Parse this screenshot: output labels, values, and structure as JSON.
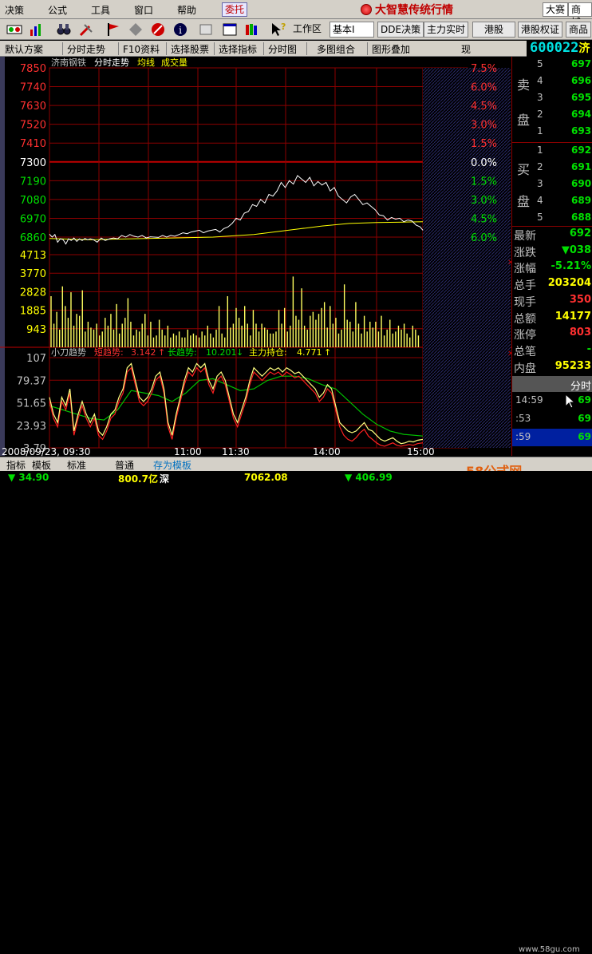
{
  "menu": {
    "items": [
      "决策",
      "公式",
      "工具",
      "窗口",
      "帮助"
    ],
    "weituo": "委托",
    "brand_title": "大智慧传统行情",
    "dasai": "大赛",
    "shangcheng": "商城"
  },
  "toolbar": {
    "workspace_label": "工作区",
    "workspace_value": "基本I",
    "buttons": [
      "DDE决策",
      "主力实时",
      "港股",
      "港股权证",
      "商品"
    ]
  },
  "funcbar": {
    "buttons": [
      "默认方案",
      "分时走势",
      "F10资料",
      "选择股票",
      "选择指标",
      "分时图",
      "多图组合",
      "图形叠加",
      "现"
    ]
  },
  "stock": {
    "code": "600022",
    "name": "济南钢铁",
    "short": "济"
  },
  "chart_data": {
    "type": "line",
    "title": "济南钢铁",
    "tags": [
      "分时走势",
      "均线",
      "成交量"
    ],
    "price_axis": [
      "7850",
      "7740",
      "7630",
      "7520",
      "7410",
      "7300",
      "7190",
      "7080",
      "6970",
      "6860"
    ],
    "pct_axis": [
      "7.5%",
      "6.0%",
      "4.5%",
      "3.0%",
      "1.5%",
      "0.0%",
      "1.5%",
      "3.0%",
      "4.5%",
      "6.0%"
    ],
    "prev_close": 7300,
    "ylim": [
      6860,
      7850
    ],
    "volume_axis": [
      "4713",
      "3770",
      "2828",
      "1885",
      "943"
    ],
    "indicator": {
      "name": "小刀趋势",
      "short_label": "短趋势:",
      "short_value": "3.142",
      "short_arrow": "↑",
      "long_label": "长趋势:",
      "long_value": "10.201",
      "long_arrow": "↓",
      "main_label": "主力持仓:",
      "main_value": "4.771",
      "main_arrow": "↑",
      "axis": [
        "107",
        "79.37",
        "51.65",
        "23.93",
        "3.79"
      ],
      "ylim": [
        0,
        107
      ]
    },
    "x_labels": [
      "2008/09/23, 09:30",
      "11:00",
      "11:30",
      "14:00",
      "15:00"
    ],
    "minutes": 240,
    "price_series": [
      [
        0,
        6877
      ],
      [
        2,
        6860
      ],
      [
        4,
        6875
      ],
      [
        6,
        6830
      ],
      [
        8,
        6850
      ],
      [
        10,
        6845
      ],
      [
        12,
        6820
      ],
      [
        14,
        6850
      ],
      [
        16,
        6840
      ],
      [
        18,
        6855
      ],
      [
        20,
        6835
      ],
      [
        22,
        6850
      ],
      [
        24,
        6840
      ],
      [
        26,
        6852
      ],
      [
        28,
        6845
      ],
      [
        30,
        6850
      ],
      [
        32,
        6846
      ],
      [
        35,
        6830
      ],
      [
        38,
        6855
      ],
      [
        41,
        6840
      ],
      [
        44,
        6850
      ],
      [
        47,
        6855
      ],
      [
        50,
        6850
      ],
      [
        53,
        6870
      ],
      [
        56,
        6860
      ],
      [
        59,
        6875
      ],
      [
        62,
        6865
      ],
      [
        65,
        6860
      ],
      [
        68,
        6870
      ],
      [
        71,
        6855
      ],
      [
        74,
        6862
      ],
      [
        77,
        6860
      ],
      [
        80,
        6858
      ],
      [
        83,
        6870
      ],
      [
        86,
        6860
      ],
      [
        89,
        6870
      ],
      [
        92,
        6865
      ],
      [
        95,
        6875
      ],
      [
        98,
        6885
      ],
      [
        101,
        6880
      ],
      [
        104,
        6890
      ],
      [
        107,
        6895
      ],
      [
        110,
        6900
      ],
      [
        113,
        6885
      ],
      [
        116,
        6895
      ],
      [
        119,
        6900
      ],
      [
        122,
        6905
      ],
      [
        125,
        6890
      ],
      [
        128,
        6910
      ],
      [
        131,
        6920
      ],
      [
        134,
        6940
      ],
      [
        137,
        6970
      ],
      [
        140,
        6960
      ],
      [
        143,
        7000
      ],
      [
        146,
        7010
      ],
      [
        149,
        7050
      ],
      [
        152,
        7040
      ],
      [
        155,
        7080
      ],
      [
        158,
        7060
      ],
      [
        161,
        7110
      ],
      [
        164,
        7100
      ],
      [
        167,
        7130
      ],
      [
        170,
        7180
      ],
      [
        173,
        7150
      ],
      [
        176,
        7190
      ],
      [
        179,
        7170
      ],
      [
        182,
        7220
      ],
      [
        185,
        7200
      ],
      [
        188,
        7180
      ],
      [
        191,
        7210
      ],
      [
        194,
        7160
      ],
      [
        197,
        7185
      ],
      [
        200,
        7165
      ],
      [
        203,
        7180
      ],
      [
        206,
        7130
      ],
      [
        209,
        7150
      ],
      [
        212,
        7100
      ],
      [
        215,
        7080
      ],
      [
        218,
        7060
      ],
      [
        221,
        7095
      ],
      [
        224,
        7110
      ],
      [
        227,
        7080
      ],
      [
        230,
        7050
      ],
      [
        233,
        7060
      ],
      [
        236,
        7040
      ],
      [
        239,
        7020
      ],
      [
        242,
        6990
      ],
      [
        245,
        6985
      ],
      [
        248,
        6960
      ],
      [
        251,
        6975
      ],
      [
        254,
        6965
      ],
      [
        257,
        6970
      ],
      [
        260,
        6950
      ],
      [
        263,
        6960
      ],
      [
        266,
        6955
      ],
      [
        269,
        6930
      ],
      [
        272,
        6920
      ],
      [
        274,
        6900
      ]
    ],
    "avg_series": [
      [
        0,
        6852
      ],
      [
        30,
        6845
      ],
      [
        60,
        6850
      ],
      [
        90,
        6855
      ],
      [
        120,
        6860
      ],
      [
        150,
        6875
      ],
      [
        180,
        6905
      ],
      [
        200,
        6925
      ],
      [
        220,
        6940
      ],
      [
        240,
        6945
      ],
      [
        260,
        6948
      ],
      [
        274,
        6950
      ]
    ],
    "volume_series": [
      2600,
      1200,
      1800,
      900,
      3100,
      2100,
      1500,
      2800,
      1100,
      1700,
      1600,
      2900,
      800,
      1300,
      1000,
      900,
      1200,
      600,
      800,
      1500,
      1100,
      1700,
      900,
      2200,
      700,
      1200,
      1500,
      2500,
      1300,
      600,
      900,
      800,
      1200,
      1700,
      600,
      1300,
      500,
      600,
      1400,
      900,
      600,
      1100,
      500,
      700,
      600,
      800,
      500,
      500,
      900,
      600,
      700,
      600,
      500,
      800,
      600,
      1100,
      700,
      500,
      900,
      2100,
      700,
      500,
      2600,
      1000,
      1200,
      2000,
      1500,
      1100,
      2100,
      1200,
      600,
      1900,
      1200,
      800,
      1200,
      1000,
      900,
      700,
      700,
      800,
      1900,
      1200,
      2000,
      800,
      1100,
      3600,
      1600,
      1400,
      3000,
      1100,
      900,
      1600,
      1800,
      1400,
      1700,
      2000,
      2300,
      1000,
      2100,
      1200,
      1500,
      700,
      900,
      3200,
      1400,
      1300,
      800,
      2300,
      1200,
      700,
      1600,
      800,
      1300,
      1000,
      1300,
      800,
      1600,
      600,
      900,
      1400,
      700,
      800,
      1100,
      900,
      1200,
      700,
      500,
      1100,
      900,
      600
    ],
    "short_series": [
      [
        0,
        60
      ],
      [
        3,
        40
      ],
      [
        6,
        30
      ],
      [
        9,
        60
      ],
      [
        12,
        50
      ],
      [
        15,
        70
      ],
      [
        18,
        20
      ],
      [
        21,
        40
      ],
      [
        24,
        55
      ],
      [
        27,
        40
      ],
      [
        30,
        30
      ],
      [
        33,
        40
      ],
      [
        36,
        20
      ],
      [
        39,
        15
      ],
      [
        42,
        25
      ],
      [
        45,
        40
      ],
      [
        48,
        45
      ],
      [
        51,
        60
      ],
      [
        54,
        70
      ],
      [
        57,
        95
      ],
      [
        60,
        100
      ],
      [
        63,
        80
      ],
      [
        66,
        60
      ],
      [
        69,
        55
      ],
      [
        72,
        60
      ],
      [
        75,
        70
      ],
      [
        78,
        85
      ],
      [
        81,
        90
      ],
      [
        84,
        70
      ],
      [
        87,
        30
      ],
      [
        90,
        15
      ],
      [
        93,
        40
      ],
      [
        96,
        60
      ],
      [
        99,
        80
      ],
      [
        102,
        95
      ],
      [
        105,
        90
      ],
      [
        108,
        100
      ],
      [
        111,
        95
      ],
      [
        114,
        100
      ],
      [
        117,
        80
      ],
      [
        120,
        70
      ],
      [
        123,
        85
      ],
      [
        126,
        90
      ],
      [
        129,
        80
      ],
      [
        132,
        60
      ],
      [
        135,
        40
      ],
      [
        138,
        30
      ],
      [
        141,
        45
      ],
      [
        144,
        60
      ],
      [
        147,
        80
      ],
      [
        150,
        95
      ],
      [
        153,
        90
      ],
      [
        156,
        85
      ],
      [
        159,
        90
      ],
      [
        162,
        95
      ],
      [
        165,
        92
      ],
      [
        168,
        95
      ],
      [
        171,
        90
      ],
      [
        174,
        95
      ],
      [
        177,
        92
      ],
      [
        180,
        88
      ],
      [
        183,
        90
      ],
      [
        186,
        85
      ],
      [
        189,
        80
      ],
      [
        192,
        75
      ],
      [
        195,
        70
      ],
      [
        198,
        60
      ],
      [
        201,
        65
      ],
      [
        204,
        75
      ],
      [
        207,
        70
      ],
      [
        210,
        50
      ],
      [
        213,
        30
      ],
      [
        216,
        25
      ],
      [
        219,
        20
      ],
      [
        222,
        18
      ],
      [
        225,
        20
      ],
      [
        228,
        25
      ],
      [
        231,
        30
      ],
      [
        234,
        22
      ],
      [
        237,
        20
      ],
      [
        240,
        15
      ],
      [
        243,
        10
      ],
      [
        246,
        8
      ],
      [
        249,
        10
      ],
      [
        252,
        12
      ],
      [
        255,
        8
      ],
      [
        258,
        5
      ],
      [
        261,
        6
      ],
      [
        264,
        8
      ],
      [
        267,
        7
      ],
      [
        270,
        9
      ],
      [
        274,
        10
      ]
    ],
    "long_series": [
      [
        0,
        50
      ],
      [
        10,
        45
      ],
      [
        20,
        40
      ],
      [
        30,
        35
      ],
      [
        40,
        33
      ],
      [
        50,
        45
      ],
      [
        60,
        68
      ],
      [
        70,
        65
      ],
      [
        80,
        62
      ],
      [
        90,
        55
      ],
      [
        100,
        65
      ],
      [
        110,
        80
      ],
      [
        120,
        82
      ],
      [
        130,
        75
      ],
      [
        140,
        68
      ],
      [
        150,
        70
      ],
      [
        160,
        80
      ],
      [
        170,
        85
      ],
      [
        180,
        85
      ],
      [
        190,
        82
      ],
      [
        200,
        75
      ],
      [
        210,
        70
      ],
      [
        220,
        55
      ],
      [
        230,
        40
      ],
      [
        240,
        28
      ],
      [
        250,
        20
      ],
      [
        260,
        16
      ],
      [
        274,
        14
      ]
    ],
    "main_series": [
      [
        0,
        55
      ],
      [
        3,
        35
      ],
      [
        6,
        25
      ],
      [
        9,
        55
      ],
      [
        12,
        45
      ],
      [
        15,
        65
      ],
      [
        18,
        15
      ],
      [
        21,
        35
      ],
      [
        24,
        50
      ],
      [
        27,
        35
      ],
      [
        30,
        25
      ],
      [
        33,
        35
      ],
      [
        36,
        15
      ],
      [
        39,
        10
      ],
      [
        42,
        20
      ],
      [
        45,
        35
      ],
      [
        48,
        40
      ],
      [
        51,
        55
      ],
      [
        54,
        65
      ],
      [
        57,
        90
      ],
      [
        60,
        95
      ],
      [
        63,
        75
      ],
      [
        66,
        55
      ],
      [
        69,
        50
      ],
      [
        72,
        55
      ],
      [
        75,
        65
      ],
      [
        78,
        80
      ],
      [
        81,
        85
      ],
      [
        84,
        65
      ],
      [
        87,
        25
      ],
      [
        90,
        10
      ],
      [
        93,
        35
      ],
      [
        96,
        55
      ],
      [
        99,
        75
      ],
      [
        102,
        90
      ],
      [
        105,
        85
      ],
      [
        108,
        95
      ],
      [
        111,
        90
      ],
      [
        114,
        95
      ],
      [
        117,
        75
      ],
      [
        120,
        65
      ],
      [
        123,
        80
      ],
      [
        126,
        85
      ],
      [
        129,
        75
      ],
      [
        132,
        55
      ],
      [
        135,
        35
      ],
      [
        138,
        25
      ],
      [
        141,
        40
      ],
      [
        144,
        55
      ],
      [
        147,
        75
      ],
      [
        150,
        90
      ],
      [
        153,
        85
      ],
      [
        156,
        80
      ],
      [
        159,
        85
      ],
      [
        162,
        90
      ],
      [
        165,
        87
      ],
      [
        168,
        90
      ],
      [
        171,
        85
      ],
      [
        174,
        90
      ],
      [
        177,
        87
      ],
      [
        180,
        83
      ],
      [
        183,
        85
      ],
      [
        186,
        80
      ],
      [
        189,
        75
      ],
      [
        192,
        70
      ],
      [
        195,
        65
      ],
      [
        198,
        55
      ],
      [
        201,
        60
      ],
      [
        204,
        70
      ],
      [
        207,
        65
      ],
      [
        210,
        45
      ],
      [
        213,
        25
      ],
      [
        216,
        15
      ],
      [
        219,
        10
      ],
      [
        222,
        8
      ],
      [
        225,
        12
      ],
      [
        228,
        18
      ],
      [
        231,
        22
      ],
      [
        234,
        14
      ],
      [
        237,
        10
      ],
      [
        240,
        6
      ],
      [
        243,
        3
      ],
      [
        246,
        2
      ],
      [
        249,
        4
      ],
      [
        252,
        6
      ],
      [
        255,
        3
      ],
      [
        258,
        2
      ],
      [
        261,
        3
      ],
      [
        264,
        4
      ],
      [
        267,
        3
      ],
      [
        270,
        5
      ],
      [
        274,
        6
      ]
    ]
  },
  "quote": {
    "sell_label_1": "卖",
    "sell_label_2": "盘",
    "buy_label_1": "买",
    "buy_label_2": "盘",
    "sell": [
      {
        "lev": "5",
        "price": "697"
      },
      {
        "lev": "4",
        "price": "696"
      },
      {
        "lev": "3",
        "price": "695"
      },
      {
        "lev": "2",
        "price": "694"
      },
      {
        "lev": "1",
        "price": "693"
      }
    ],
    "buy": [
      {
        "lev": "1",
        "price": "692"
      },
      {
        "lev": "2",
        "price": "691"
      },
      {
        "lev": "3",
        "price": "690"
      },
      {
        "lev": "4",
        "price": "689"
      },
      {
        "lev": "5",
        "price": "688"
      }
    ]
  },
  "stats": [
    {
      "label": "最新",
      "value": "692"
    },
    {
      "label": "涨跌",
      "value": "▼038"
    },
    {
      "label": "涨幅",
      "value": "-5.21%"
    },
    {
      "label": "总手",
      "value": "203204"
    },
    {
      "label": "现手",
      "value": "350"
    },
    {
      "label": "总额",
      "value": "14177"
    },
    {
      "label": "涨停",
      "value": "803"
    },
    {
      "label": "总笔",
      "value": "-"
    },
    {
      "label": "内盘",
      "value": "95233"
    }
  ],
  "ticks": {
    "header": "分时",
    "rows": [
      {
        "time": "14:59",
        "price": "69"
      },
      {
        "time": ":53",
        "price": "69"
      },
      {
        "time": ":59",
        "price": "69"
      }
    ]
  },
  "tabs": [
    "指标",
    "模板",
    "标准",
    "普通",
    "存为模板"
  ],
  "status": [
    {
      "text": "▼ 34.90",
      "color": "#00e000"
    },
    {
      "text": "800.7亿",
      "color": "#ffff00"
    },
    {
      "text": "深",
      "color": "#ffffff"
    },
    {
      "text": "7062.08",
      "color": "#ffff00"
    },
    {
      "text": "▼ 406.99",
      "color": "#00e000"
    }
  ],
  "watermark": "58公式网",
  "watermark_url": "www.58gu.com"
}
